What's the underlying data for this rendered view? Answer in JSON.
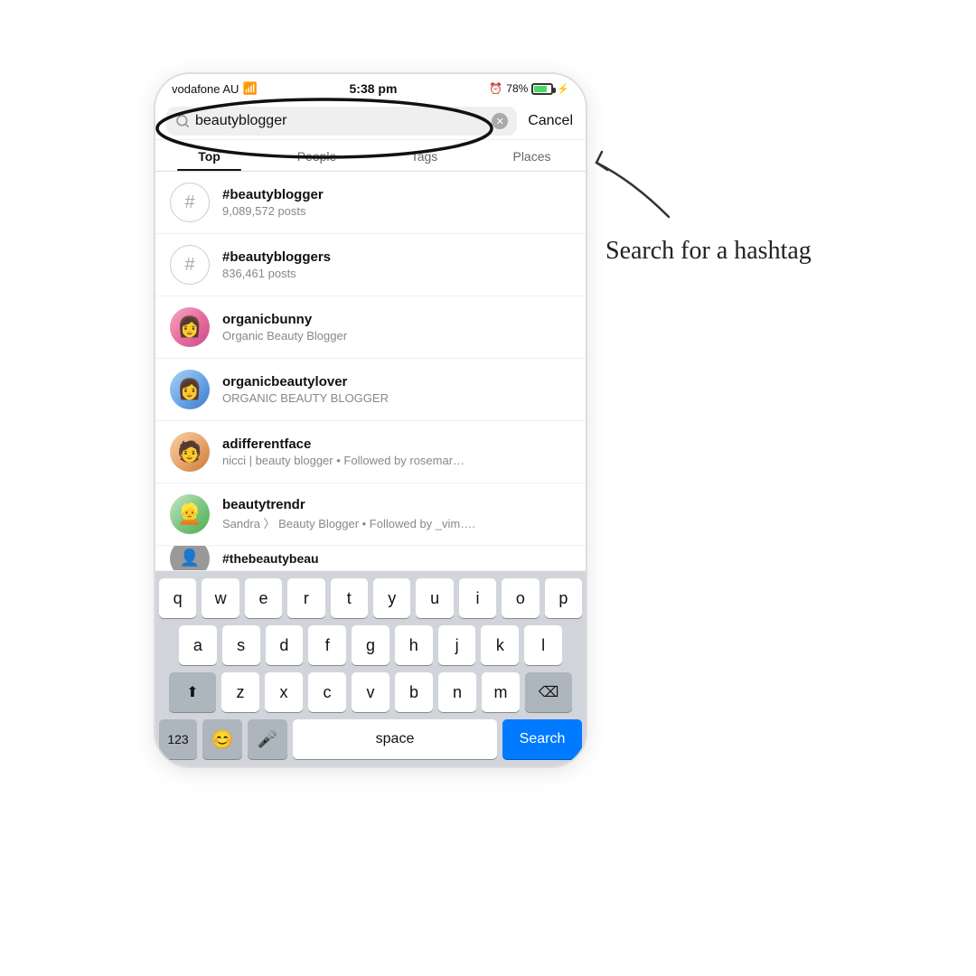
{
  "statusBar": {
    "carrier": "vodafone AU",
    "wifi": "wifi",
    "time": "5:38 pm",
    "alarm": "alarm",
    "battery": "78%"
  },
  "searchBar": {
    "query": "beautyblogger",
    "cancelLabel": "Cancel",
    "placeholder": "Search"
  },
  "tabs": [
    {
      "label": "Top",
      "active": true
    },
    {
      "label": "People",
      "active": false
    },
    {
      "label": "Tags",
      "active": false
    },
    {
      "label": "Places",
      "active": false
    }
  ],
  "results": [
    {
      "type": "hashtag",
      "name": "#beautyblogger",
      "sub": "9,089,572 posts"
    },
    {
      "type": "hashtag",
      "name": "#beautybloggers",
      "sub": "836,461 posts"
    },
    {
      "type": "user",
      "username": "organicbunny",
      "bio": "Organic Beauty Blogger",
      "avatarClass": "avatar-1"
    },
    {
      "type": "user",
      "username": "organicbeautylover",
      "bio": "ORGANIC BEAUTY BLOGGER",
      "avatarClass": "avatar-2"
    },
    {
      "type": "user",
      "username": "adifferentface",
      "bio": "nicci | beauty blogger • Followed by rosemar…",
      "avatarClass": "avatar-3"
    },
    {
      "type": "user",
      "username": "beautytrendr",
      "bio": "Sandra 〉 Beauty Blogger • Followed by _vim….",
      "avatarClass": "avatar-4"
    }
  ],
  "keyboard": {
    "row1": [
      "q",
      "w",
      "e",
      "r",
      "t",
      "y",
      "u",
      "i",
      "o",
      "p"
    ],
    "row2": [
      "a",
      "s",
      "d",
      "f",
      "g",
      "h",
      "j",
      "k",
      "l"
    ],
    "row3": [
      "z",
      "x",
      "c",
      "v",
      "b",
      "n",
      "m"
    ],
    "bottomRow": {
      "numeric": "123",
      "space": "space",
      "search": "Search"
    }
  },
  "annotation": {
    "text": "Search for a hashtag"
  }
}
